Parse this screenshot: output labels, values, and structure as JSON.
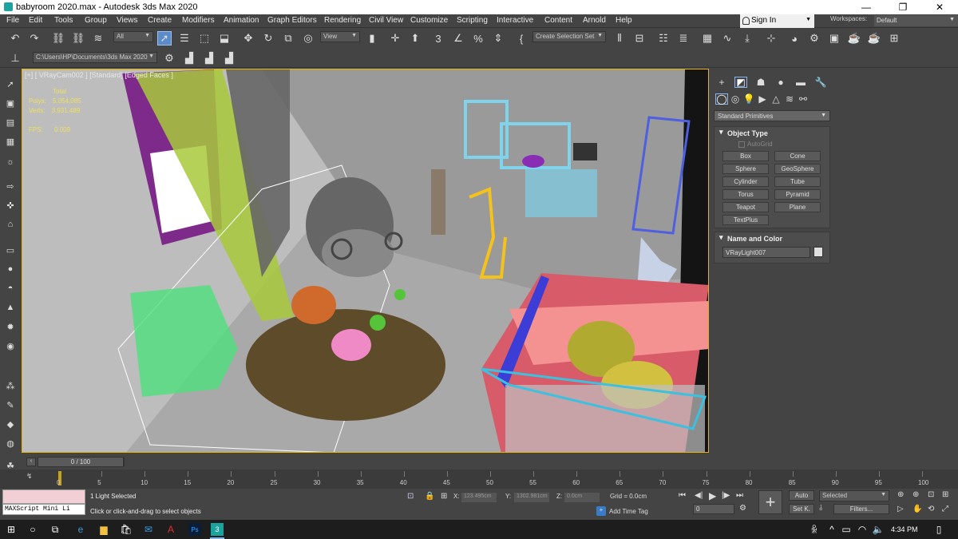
{
  "titlebar": {
    "title": "babyroom 2020.max - Autodesk 3ds Max 2020",
    "minimize": "—",
    "maximize": "❐",
    "close": "✕"
  },
  "menu": [
    "File",
    "Edit",
    "Tools",
    "Group",
    "Views",
    "Create",
    "Modifiers",
    "Animation",
    "Graph Editors",
    "Rendering",
    "Civil View",
    "Customize",
    "Scripting",
    "Interactive",
    "Content",
    "Arnold",
    "Help"
  ],
  "signin": {
    "label": "Sign In"
  },
  "workspaces": {
    "label": "Workspaces:",
    "value": "Default"
  },
  "toolbar": {
    "filter": "All",
    "ref_coord": "View",
    "named_selection": "Create Selection Set",
    "project_path": "C:\\Users\\HP\\Documents\\3ds Max 2020"
  },
  "viewport": {
    "label": "[+] [ VRayCam002 ] [Standard] [Edged Faces ]",
    "stats": {
      "total_label": "Total",
      "polys_label": "Polys:",
      "polys": "5,054,085",
      "verts_label": "Verts:",
      "verts": "3,931,489",
      "fps_label": "FPS:",
      "fps": "0.009"
    }
  },
  "command_panel": {
    "category": "Standard Primitives",
    "object_type": {
      "title": "Object Type",
      "autogrid": "AutoGrid",
      "buttons": [
        "Box",
        "Cone",
        "Sphere",
        "GeoSphere",
        "Cylinder",
        "Tube",
        "Torus",
        "Pyramid",
        "Teapot",
        "Plane",
        "TextPlus"
      ]
    },
    "name_color": {
      "title": "Name and Color",
      "name": "VRayLight007",
      "color": "#e0e0e0"
    }
  },
  "timeline": {
    "frame": "0 / 100",
    "ticks": [
      "5",
      "10",
      "15",
      "20",
      "25",
      "30",
      "35",
      "40",
      "45",
      "50",
      "55",
      "60",
      "65",
      "70",
      "75",
      "80",
      "85",
      "90",
      "95",
      "100"
    ],
    "start_mark": "0"
  },
  "status": {
    "selected": "1 Light Selected",
    "prompt": "Click or click-and-drag to select objects",
    "maxscript": "MAXScript Mini Li",
    "x_label": "X:",
    "x": "123.495cm",
    "y_label": "Y:",
    "y": "1302.981cm",
    "z_label": "Z:",
    "z": "0.0cm",
    "grid": "Grid = 0.0cm",
    "add_time_tag": "Add Time Tag",
    "auto": "Auto",
    "set_key": "Set K.",
    "key_filter": "Selected",
    "filters": "Filters...",
    "frame": "0"
  },
  "taskbar": {
    "time": "4:34 PM"
  }
}
